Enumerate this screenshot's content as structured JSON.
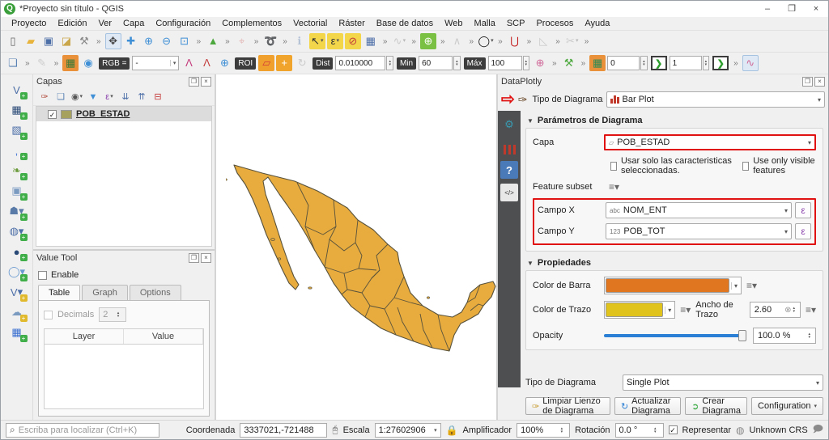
{
  "window": {
    "title": "*Proyecto sin título - QGIS",
    "minimize": "–",
    "maximize": "❐",
    "close": "×",
    "logo": "Q"
  },
  "menu": {
    "items": [
      "Proyecto",
      "Edición",
      "Ver",
      "Capa",
      "Configuración",
      "Complementos",
      "Vectorial",
      "Ráster",
      "Base de datos",
      "Web",
      "Malla",
      "SCP",
      "Procesos",
      "Ayuda"
    ]
  },
  "toolbar1": {
    "icons": [
      {
        "n": "new-project",
        "ch": "▯",
        "fg": "#666"
      },
      {
        "n": "open-project",
        "ch": "▰",
        "fg": "#e8b33a"
      },
      {
        "n": "save-project",
        "ch": "▣",
        "fg": "#4d6fa8"
      },
      {
        "n": "style-manager",
        "ch": "◪",
        "fg": "#caa64a"
      },
      {
        "n": "project-properties",
        "ch": "⚒",
        "fg": "#8a8a8a"
      },
      {
        "sep": true
      },
      {
        "n": "pan-map",
        "ch": "✥",
        "fg": "#444",
        "p": true
      },
      {
        "n": "pan-to-selection",
        "ch": "✚",
        "fg": "#3f8fd6"
      },
      {
        "n": "zoom-in",
        "ch": "⊕",
        "fg": "#3f8fd6"
      },
      {
        "n": "zoom-out",
        "ch": "⊖",
        "fg": "#3f8fd6"
      },
      {
        "n": "zoom-full",
        "ch": "⊡",
        "fg": "#3f8fd6"
      },
      {
        "sep": true
      },
      {
        "n": "grass-tools",
        "ch": "▲",
        "fg": "#4ca83d"
      },
      {
        "sep": true
      },
      {
        "n": "snapping",
        "ch": "⌖",
        "fg": "#d05050",
        "g": true
      },
      {
        "sep": true
      },
      {
        "n": "python-console",
        "ch": "➰",
        "fg": "#d8a227"
      },
      {
        "sep": true
      },
      {
        "n": "identify-features",
        "ch": "ℹ",
        "fg": "#4d6fa8",
        "g": true
      },
      {
        "n": "select-features",
        "ch": "↖",
        "bg": "#f3d64a",
        "fg": "#333",
        "dd": true
      },
      {
        "n": "select-by-expression",
        "ch": "ε",
        "bg": "#f3d64a",
        "fg": "#333",
        "dd": true
      },
      {
        "n": "deselect-features",
        "ch": "⊘",
        "bg": "#f3d64a",
        "fg": "#c23a3a"
      },
      {
        "n": "open-attribute-table",
        "ch": "▦",
        "fg": "#4d6fa8"
      },
      {
        "sep": true
      },
      {
        "n": "vertex-tool",
        "ch": "∿",
        "fg": "#888",
        "g": true,
        "dd": true
      },
      {
        "sep": true
      },
      {
        "n": "zoom-to-native",
        "ch": "⊕",
        "bg": "#7ac143",
        "fg": "#fff"
      },
      {
        "sep": true
      },
      {
        "n": "raster-histogram",
        "ch": "∧",
        "fg": "#888",
        "g": true
      },
      {
        "sep": true
      },
      {
        "n": "circle-tool",
        "ch": "◯",
        "fg": "#111",
        "dd": true
      },
      {
        "sep": true
      },
      {
        "n": "snapping-magnet",
        "ch": "⋃",
        "fg": "#c42020"
      },
      {
        "sep": true
      },
      {
        "n": "measure-tool",
        "ch": "◺",
        "fg": "#888",
        "g": true
      },
      {
        "sep": true
      },
      {
        "n": "node-tool",
        "ch": "✂",
        "fg": "#888",
        "g": true,
        "dd": true
      },
      {
        "sep": true
      }
    ]
  },
  "toolbar2": {
    "icons_a": [
      {
        "n": "add-layer-group",
        "ch": "❏",
        "fg": "#5a82b4"
      },
      {
        "sep": true
      },
      {
        "n": "digitize",
        "ch": "✎",
        "fg": "#888",
        "g": true
      },
      {
        "sep": true
      },
      {
        "n": "scp-bandset",
        "ch": "▦",
        "bg": "#e8913a",
        "fg": "#3b7a3b"
      },
      {
        "n": "scp-preview",
        "ch": "◉",
        "fg": "#3f8fd6"
      }
    ],
    "rgb_label": "RGB =",
    "rgb_value": "-",
    "icons_b": [
      {
        "n": "spectral-signature",
        "ch": "Λ",
        "fg": "#c43a7a"
      },
      {
        "n": "spectral-plot",
        "ch": "Λ",
        "fg": "#c43a3a"
      },
      {
        "n": "roi-zoom",
        "ch": "⊕",
        "fg": "#3f8fd6"
      }
    ],
    "roi_label": "ROI",
    "icons_c": [
      {
        "n": "roi-polygon",
        "ch": "▱",
        "bg": "#f0a02c",
        "fg": "#d23a3a"
      },
      {
        "n": "roi-add",
        "ch": "+",
        "bg": "#f0a42c",
        "fg": "#fff"
      },
      {
        "n": "roi-undo",
        "ch": "↻",
        "fg": "#888",
        "g": true
      }
    ],
    "dist_label": "Dist",
    "dist_value": "0.010000",
    "min_label": "Min",
    "min_value": "60",
    "max_label": "Máx",
    "max_value": "100",
    "icons_d": [
      {
        "n": "scp-zoom-plus",
        "ch": "⊕",
        "fg": "#d06a9a"
      },
      {
        "sep": true
      },
      {
        "n": "scp-tools",
        "ch": "⚒",
        "fg": "#4ca83d"
      },
      {
        "sep": true
      },
      {
        "n": "raster-calc",
        "ch": "▦",
        "bg": "#e8913a",
        "fg": "#2e8b57"
      }
    ],
    "spin1_value": "0",
    "spin2_value": "1",
    "run_glyph": "❯"
  },
  "left_rail": {
    "icons": [
      {
        "n": "add-vector-layer",
        "ch": "V",
        "fg": "#4d6fa8"
      },
      {
        "n": "add-raster-layer",
        "ch": "▦",
        "fg": "#2b4a77"
      },
      {
        "n": "add-mesh-layer",
        "ch": "▧",
        "fg": "#4d6fa8"
      },
      {
        "n": "add-delimited-text",
        "ch": "‚",
        "fg": "#3a6fd0"
      },
      {
        "n": "add-geopackage",
        "ch": "❧",
        "fg": "#6a9a3a"
      },
      {
        "n": "add-spatialite",
        "ch": "▣",
        "fg": "#7a9ac0"
      },
      {
        "n": "add-postgis",
        "ch": "☗",
        "fg": "#5a7aa8",
        "dd": true
      },
      {
        "n": "add-wms",
        "ch": "◍",
        "fg": "#4d6fa8",
        "dd": true
      },
      {
        "n": "add-wcs",
        "ch": "●",
        "fg": "#2b4a77"
      },
      {
        "n": "add-wfs",
        "ch": "◯",
        "fg": "#6a9ad0",
        "dd": true
      },
      {
        "n": "add-virtual-layer",
        "ch": "V",
        "fg": "#4d6fa8",
        "yb": true,
        "dd": true
      },
      {
        "n": "add-point-cloud",
        "ch": "☁",
        "fg": "#7a9ac0",
        "yb": true
      },
      {
        "n": "add-attribute-grid",
        "ch": "▦",
        "fg": "#3a6fd0"
      }
    ]
  },
  "capas_panel": {
    "title": "Capas",
    "toolbar": [
      {
        "n": "open-layer-styling",
        "ch": "✑",
        "fg": "#b04a3a"
      },
      {
        "n": "add-group",
        "ch": "❏",
        "fg": "#5a82b4"
      },
      {
        "n": "manage-visibility",
        "ch": "◉",
        "fg": "#555",
        "dd": true
      },
      {
        "n": "filter-legend",
        "ch": "▼",
        "fg": "#3f8fd6"
      },
      {
        "n": "filter-by-expression",
        "ch": "ε",
        "fg": "#8b44ad",
        "dd": true
      },
      {
        "n": "expand-all",
        "ch": "⇊",
        "fg": "#4d6fa8"
      },
      {
        "n": "collapse-all",
        "ch": "⇈",
        "fg": "#4d6fa8"
      },
      {
        "n": "remove-layer",
        "ch": "⊟",
        "fg": "#c43a3a"
      }
    ],
    "layer": {
      "name": "POB_ESTAD",
      "checked": "✓",
      "swatch_color": "#a7a15f"
    }
  },
  "value_tool": {
    "title": "Value Tool",
    "enable_label": "Enable",
    "tabs": {
      "table": "Table",
      "graph": "Graph",
      "options": "Options"
    },
    "decimals_label": "Decimals",
    "decimals_value": "2",
    "columns": {
      "layer": "Layer",
      "value": "Value"
    }
  },
  "map": {
    "fill": "#e7ab3e",
    "stroke": "#58523c"
  },
  "dataplotly": {
    "title": "DataPlotly",
    "plot_type_label": "Tipo de Diagrama",
    "plot_type_value": "Bar Plot",
    "params_section": "Parámetros de Diagrama",
    "capa_label": "Capa",
    "capa_value": "POB_ESTAD",
    "chk_selected": "Usar solo las caracteristicas seleccionadas.",
    "chk_visible": "Use only visible features",
    "feature_subset_label": "Feature subset",
    "campo_x_label": "Campo X",
    "campo_x_type": "abc",
    "campo_x_value": "NOM_ENT",
    "campo_y_label": "Campo Y",
    "campo_y_type": "123",
    "campo_y_value": "POB_TOT",
    "epsilon": "ε",
    "props_section": "Propiedades",
    "bar_color_label": "Color de Barra",
    "bar_color": "#e0761f",
    "stroke_color_label": "Color de Trazo",
    "stroke_color": "#e0c31d",
    "stroke_width_label": "Ancho de Trazo",
    "stroke_width_value": "2.60",
    "opacity_label": "Opacity",
    "opacity_value": "100.0 %",
    "bottom_type_label": "Tipo de Diagrama",
    "bottom_type_value": "Single Plot",
    "buttons": {
      "clean": "Limpiar Lienzo de Diagrama",
      "update": "Actualizar Diagrama",
      "create": "Crear Diagrama",
      "config": "Configuration"
    }
  },
  "statusbar": {
    "search_placeholder": "Escriba para localizar (Ctrl+K)",
    "coord_label": "Coordenada",
    "coord_value": "3337021,-721488",
    "scale_label": "Escala",
    "scale_value": "1:27602906",
    "magnifier_label": "Amplificador",
    "magnifier_value": "100%",
    "rotation_label": "Rotación",
    "rotation_value": "0.0 °",
    "render_label": "Representar",
    "crs_label": "Unknown CRS"
  }
}
